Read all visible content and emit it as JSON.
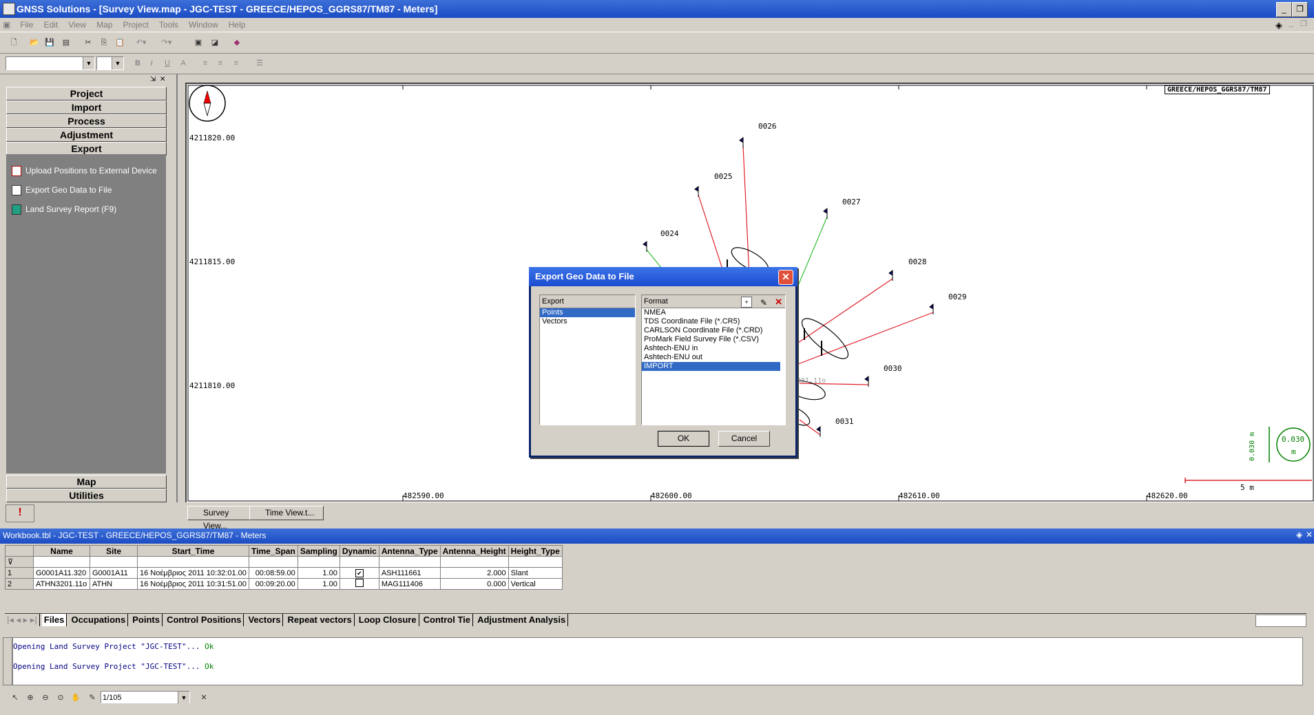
{
  "window": {
    "title": "GNSS Solutions - [Survey View.map - JGC-TEST - GREECE/HEPOS_GGRS87/TM87 - Meters]"
  },
  "menu": [
    "File",
    "Edit",
    "View",
    "Map",
    "Project",
    "Tools",
    "Window",
    "Help"
  ],
  "toolbar": {
    "icons": [
      "new-icon",
      "open-icon",
      "save-icon",
      "save-all-icon",
      "cut-icon",
      "copy-icon",
      "paste-icon",
      "undo-icon",
      "redo-icon",
      "view-icon",
      "layout-icon",
      "book-icon"
    ]
  },
  "format_bar": {
    "bold": "B",
    "italic": "I",
    "underline": "U",
    "color": "A"
  },
  "sidebar": {
    "buttons": [
      "Project",
      "Import",
      "Process",
      "Adjustment",
      "Export"
    ],
    "items": [
      {
        "label": "Upload Positions to External Device",
        "icon": "upload-icon"
      },
      {
        "label": "Export Geo Data to File",
        "icon": "export-file-icon"
      },
      {
        "label": "Land Survey Report (F9)",
        "icon": "report-icon"
      }
    ],
    "bottom_buttons": [
      "Map",
      "Utilities"
    ],
    "alert_tab": "!"
  },
  "map": {
    "crs_label": "GREECE/HEPOS_GGRS87/TM87",
    "y_labels": [
      "4211820.00",
      "4211815.00",
      "4211810.00"
    ],
    "x_labels": [
      "482590.00",
      "482600.00",
      "482610.00",
      "482620.00"
    ],
    "points": [
      "0024",
      "0025",
      "0026",
      "0027",
      "0028",
      "0029",
      "0030",
      "0031"
    ],
    "faded_label": "3201.11o",
    "scale_label": "5 m",
    "ellipse_value": "0.030",
    "ellipse_unit": "m",
    "ellipse_axis": "0.030 m",
    "colors": {
      "vector_red": "#e0202a",
      "vector_green": "#30c030",
      "scale": "#e0202a",
      "ellipse": "#008000"
    }
  },
  "doc_tabs": [
    "Survey View...",
    "Time View.t..."
  ],
  "workbook": {
    "title": "Workbook.tbl - JGC-TEST - GREECE/HEPOS_GGRS87/TM87 - Meters",
    "columns": [
      "Name",
      "Site",
      "Start_Time",
      "Time_Span",
      "Sampling",
      "Dynamic",
      "Antenna_Type",
      "Antenna_Height",
      "Height_Type"
    ],
    "rows": [
      [
        "1",
        "G0001A11.320",
        "G0001A11",
        "16 Νοέμβριος 2011 10:32:01.00",
        "00:08:59.00",
        "1.00",
        "✔",
        "ASH111661",
        "2.000",
        "Slant"
      ],
      [
        "2",
        "ATHN3201.11o",
        "ATHN",
        "16 Νοέμβριος 2011 10:31:51.00",
        "00:09:20.00",
        "1.00",
        "",
        "MAG111406",
        "0.000",
        "Vertical"
      ]
    ]
  },
  "sheet_tabs": [
    "Files",
    "Occupations",
    "Points",
    "Control Positions",
    "Vectors",
    "Repeat vectors",
    "Loop Closure",
    "Control Tie",
    "Adjustment Analysis"
  ],
  "console": {
    "lines": [
      {
        "text": "Opening Land Survey Project \"JGC-TEST\"...",
        "status": "Ok"
      },
      {
        "text": "Opening Land Survey Project \"JGC-TEST\"...",
        "status": "Ok"
      }
    ]
  },
  "status": {
    "page": "1/105"
  },
  "dialog": {
    "title": "Export Geo Data to File",
    "export_header": "Export",
    "export_items": [
      "Points",
      "Vectors"
    ],
    "export_selected": 0,
    "format_header": "Format",
    "format_items": [
      "NMEA",
      "TDS Coordinate File (*.CR5)",
      "CARLSON Coordinate File (*.CRD)",
      "ProMark Field Survey File (*.CSV)",
      "Ashtech-ENU in",
      "Ashtech-ENU out",
      "IMPORT"
    ],
    "format_selected": 6,
    "ok": "OK",
    "cancel": "Cancel"
  }
}
